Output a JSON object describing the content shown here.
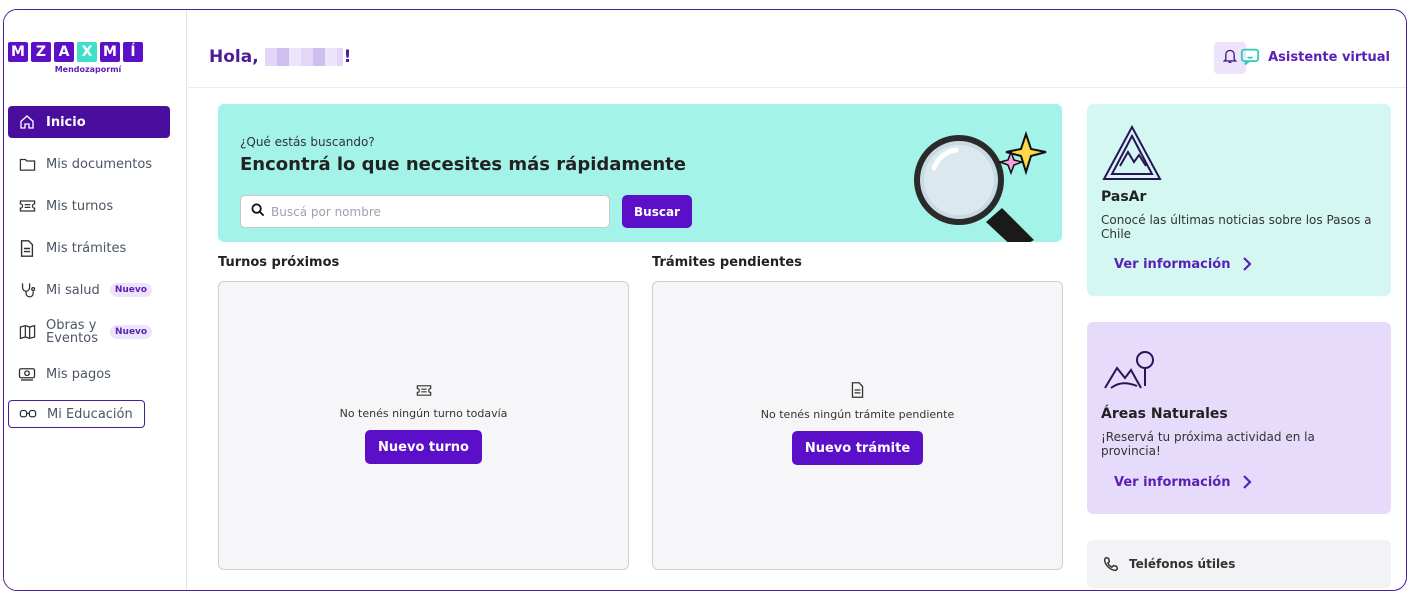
{
  "brand": {
    "letters": [
      "M",
      "Z",
      "A",
      "X",
      "M",
      "Í"
    ],
    "tile_colors": [
      "#5b0fc8",
      "#5b0fc8",
      "#5b0fc8",
      "#3ee0c8",
      "#5b0fc8",
      "#5b0fc8"
    ],
    "subtitle": "Mendozapormí"
  },
  "sidebar": {
    "items": [
      {
        "label": "Inicio",
        "icon": "home-icon"
      },
      {
        "label": "Mis documentos",
        "icon": "folder-icon"
      },
      {
        "label": "Mis turnos",
        "icon": "ticket-icon"
      },
      {
        "label": "Mis trámites",
        "icon": "file-text-icon"
      },
      {
        "label": "Mi salud",
        "icon": "stethoscope-icon",
        "badge": "Nuevo"
      },
      {
        "label": "Obras y Eventos",
        "icon": "map-icon",
        "badge": "Nuevo"
      },
      {
        "label": "Mis pagos",
        "icon": "payment-icon"
      },
      {
        "label": "Mi Educación",
        "icon": "glasses-icon"
      }
    ]
  },
  "header": {
    "greeting_prefix": "Hola,",
    "greeting_suffix": "!",
    "assistant_label": "Asistente virtual"
  },
  "search": {
    "question": "¿Qué estás buscando?",
    "heading": "Encontrá lo que necesites más rápidamente",
    "placeholder": "Buscá por nombre",
    "button_label": "Buscar"
  },
  "turnos": {
    "title": "Turnos próximos",
    "empty_text": "No tenés ningún turno todavía",
    "button_label": "Nuevo turno"
  },
  "tramites": {
    "title": "Trámites pendientes",
    "empty_text": "No tenés ningún trámite pendiente",
    "button_label": "Nuevo trámite"
  },
  "promos": [
    {
      "title": "PasAr",
      "description": "Conocé las últimas noticias sobre los Pasos a Chile",
      "link": "Ver información",
      "bg": "#d4f7f2"
    },
    {
      "title": "Áreas Naturales",
      "description": "¡Reservá tu próxima actividad en la provincia!",
      "link": "Ver información",
      "bg": "#e6dbfa"
    }
  ],
  "phones": {
    "label": "Teléfonos útiles"
  },
  "colors": {
    "primary": "#5b0fc8",
    "accent_teal": "#a3f3e9",
    "dark_purple": "#4a0e9e"
  }
}
